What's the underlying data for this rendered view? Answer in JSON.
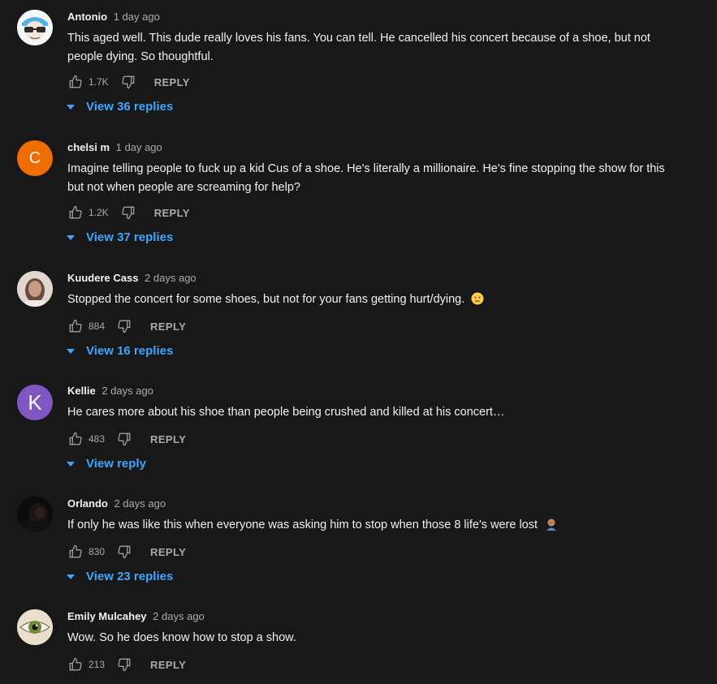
{
  "comments": [
    {
      "author": "Antonio",
      "time": "1 day ago",
      "avatar": "sunglasses-avatar",
      "text_lines": [
        "This aged well. This dude really loves his fans. You can tell. He cancelled his concert because of a shoe, but not",
        "people dying. So thoughtful."
      ],
      "likes": "1.7K",
      "reply_label": "REPLY",
      "view_replies": "View 36 replies"
    },
    {
      "author": "chelsi m",
      "time": "1 day ago",
      "avatar": "C",
      "text_lines": [
        "Imagine telling people to fuck up a kid Cus of a shoe. He's literally a millionaire. He's fine stopping the show for this",
        "but not when people are screaming for help?"
      ],
      "likes": "1.2K",
      "reply_label": "REPLY",
      "view_replies": "View 37 replies"
    },
    {
      "author": "Kuudere Cass",
      "time": "2 days ago",
      "avatar": "photo-avatar",
      "text_lines": [
        "Stopped the concert for some shoes, but not for your fans getting hurt/dying."
      ],
      "emoji": "neutral-face-emoji",
      "likes": "884",
      "reply_label": "REPLY",
      "view_replies": "View 16 replies"
    },
    {
      "author": "Kellie",
      "time": "2 days ago",
      "avatar": "K",
      "text_lines": [
        "He cares more about his shoe than people being crushed and killed at his concert…"
      ],
      "likes": "483",
      "reply_label": "REPLY",
      "view_replies": "View reply"
    },
    {
      "author": "Orlando",
      "time": "2 days ago",
      "avatar": "dark-photo-avatar",
      "text_lines": [
        "If only he was like this when everyone was asking him to stop when those 8 life's were lost"
      ],
      "emoji": "person-facepalming-emoji",
      "likes": "830",
      "reply_label": "REPLY",
      "view_replies": "View 23 replies"
    },
    {
      "author": "Emily Mulcahey",
      "time": "2 days ago",
      "avatar": "eye-photo-avatar",
      "text_lines": [
        "Wow. So he does know how to stop a show."
      ],
      "likes": "213",
      "reply_label": "REPLY"
    }
  ],
  "colors": {
    "background": "#181818",
    "text": "#f1f1f1",
    "secondary": "#aaaaaa",
    "link": "#3ea6ff",
    "avatar_c": "#ef6c00",
    "avatar_k": "#7e57c2"
  }
}
